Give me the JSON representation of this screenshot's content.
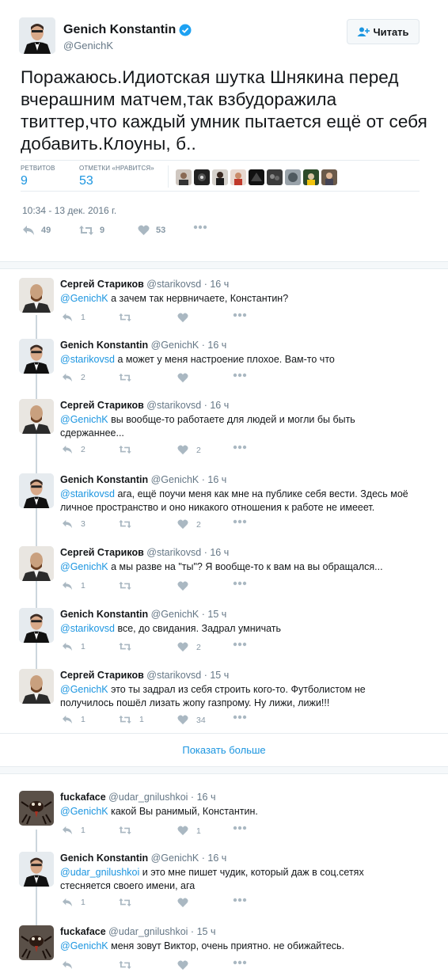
{
  "main": {
    "name": "Genich Konstantin",
    "handle": "@GenichK",
    "follow_label": "Читать",
    "text": "Поражаюсь.Идиотская шутка Шнякина перед вчерашним матчем,так взбудоражила твиттер,что каждый умник пытается ещё от себя добавить.Клоуны, б..",
    "retweets_label": "РЕТВИТОВ",
    "retweets_value": "9",
    "likes_label": "ОТМЕТКИ «НРАВИТСЯ»",
    "likes_value": "53",
    "timestamp": "10:34 - 13 дек. 2016 г.",
    "actions": {
      "retweets": "9",
      "likes": "53",
      "replies": "49"
    },
    "colors": {
      "link": "#1b95e0",
      "muted": "#657786",
      "verified": "#1da1f2"
    }
  },
  "replies": [
    {
      "name": "Сергей Стариков",
      "handle": "@starikovsd",
      "dot": "·",
      "time": "16 ч",
      "mention": "@GenichK",
      "text": " а зачем так нервничаете, Константин?",
      "reply_count": "1",
      "retweet_count": "",
      "like_count": ""
    },
    {
      "name": "Genich Konstantin",
      "handle": "@GenichK",
      "dot": "·",
      "time": "16 ч",
      "mention": "@starikovsd",
      "text": " а может у меня настроение плохое. Вам-то что",
      "reply_count": "2",
      "retweet_count": "",
      "like_count": ""
    },
    {
      "name": "Сергей Стариков",
      "handle": "@starikovsd",
      "dot": "·",
      "time": "16 ч",
      "mention": "@GenichK",
      "text": " вы вообще-то работаете для людей и могли бы быть сдержаннее...",
      "reply_count": "2",
      "retweet_count": "",
      "like_count": "2"
    },
    {
      "name": "Genich Konstantin",
      "handle": "@GenichK",
      "dot": "·",
      "time": "16 ч",
      "mention": "@starikovsd",
      "text": " ага, ещё поучи меня как мне на публике себя вести. Здесь моё личное пространство и оно никакого отношения к работе не имееет.",
      "reply_count": "3",
      "retweet_count": "",
      "like_count": "2"
    },
    {
      "name": "Сергей Стариков",
      "handle": "@starikovsd",
      "dot": "·",
      "time": "16 ч",
      "mention": "@GenichK",
      "text": " а мы разве на \"ты\"? Я вообще-то к вам на вы обращался...",
      "reply_count": "1",
      "retweet_count": "",
      "like_count": ""
    },
    {
      "name": "Genich Konstantin",
      "handle": "@GenichK",
      "dot": "·",
      "time": "15 ч",
      "mention": "@starikovsd",
      "text": " все, до свидания. Задрал умничать",
      "reply_count": "1",
      "retweet_count": "",
      "like_count": "2"
    },
    {
      "name": "Сергей Стариков",
      "handle": "@starikovsd",
      "dot": "·",
      "time": "15 ч",
      "mention": "@GenichK",
      "text": " это ты задрал из себя строить кого-то. Футболистом не получилось пошёл лизать жопу газпрому. Ну лижи, лижи!!!",
      "reply_count": "1",
      "retweet_count": "1",
      "like_count": "34"
    }
  ],
  "show_more": "Показать больше",
  "replies2": [
    {
      "name": "fuckaface",
      "handle": "@udar_gnilushkoi",
      "dot": "·",
      "time": "16 ч",
      "mention": "@GenichK",
      "text": " какой Вы ранимый, Константин.",
      "reply_count": "1",
      "retweet_count": "",
      "like_count": "1"
    },
    {
      "name": "Genich Konstantin",
      "handle": "@GenichK",
      "dot": "·",
      "time": "16 ч",
      "mention": "@udar_gnilushkoi",
      "text": " и это мне пишет чудик, который даж в соц.сетях стесняется своего имени, ага",
      "reply_count": "1",
      "retweet_count": "",
      "like_count": ""
    },
    {
      "name": "fuckaface",
      "handle": "@udar_gnilushkoi",
      "dot": "·",
      "time": "15 ч",
      "mention": "@GenichK",
      "text": " меня зовут Виктор, очень приятно. не обижайтесь.",
      "reply_count": "",
      "retweet_count": "",
      "like_count": ""
    }
  ]
}
